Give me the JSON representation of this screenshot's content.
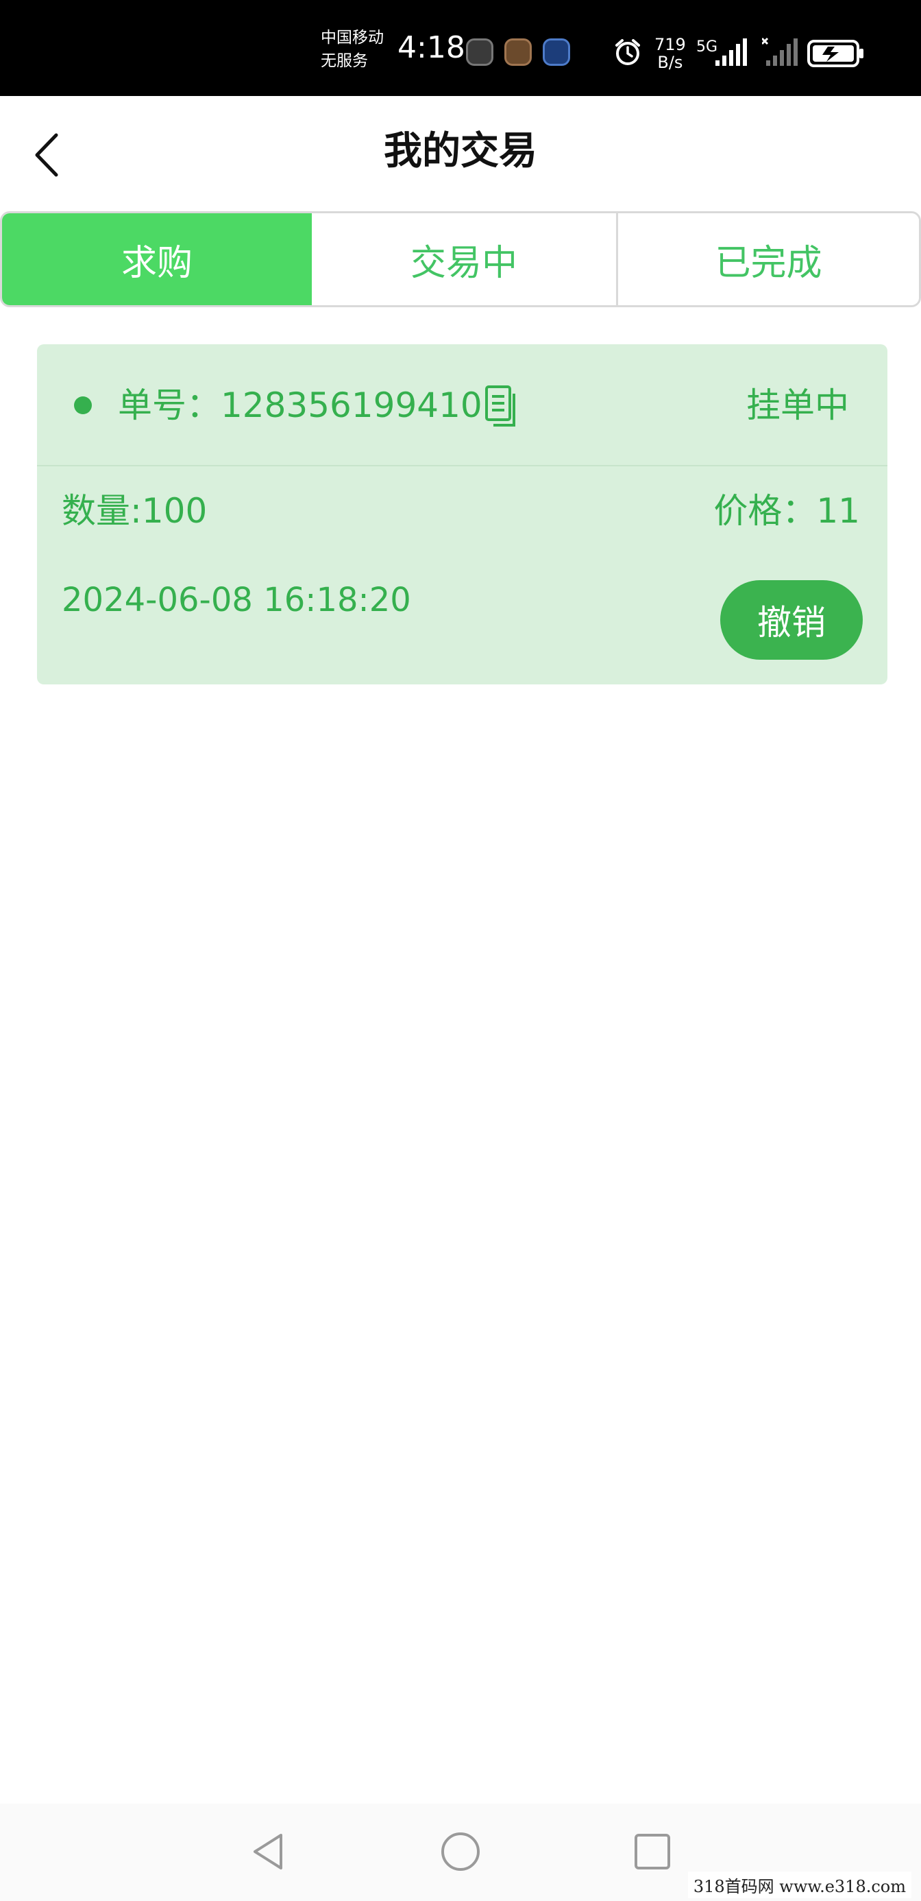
{
  "status_bar": {
    "carrier_line1": "中国移动",
    "carrier_line2": "无服务",
    "time": "4:18",
    "speed_value": "719",
    "speed_unit": "B/s",
    "network": "5G"
  },
  "header": {
    "title": "我的交易"
  },
  "tabs": [
    {
      "label": "求购",
      "active": true
    },
    {
      "label": "交易中",
      "active": false
    },
    {
      "label": "已完成",
      "active": false
    }
  ],
  "order": {
    "order_number_label": "单号：128356199410",
    "status": "挂单中",
    "quantity": "数量:100",
    "price": "价格：11",
    "datetime": "2024-06-08 16:18:20",
    "cancel_label": "撤销"
  },
  "watermark": "318首码网  www.e318.com",
  "colors": {
    "accent": "#4cd964",
    "text_green": "#35b04e",
    "card_bg": "#d9f0dc",
    "button_green": "#3bb34f"
  }
}
